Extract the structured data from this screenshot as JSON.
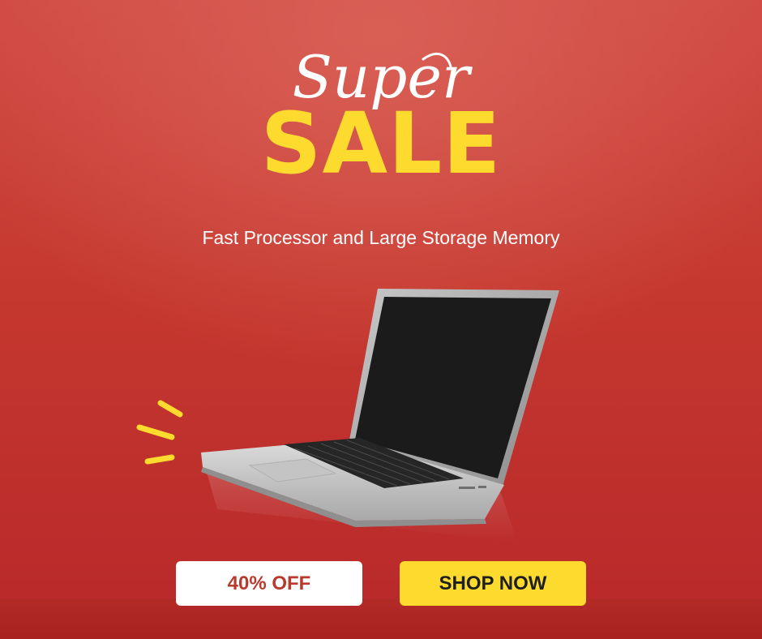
{
  "headline": {
    "script_word": "Super",
    "main_word": "SALE"
  },
  "subtitle": "Fast Processor and Large Storage Memory",
  "buttons": {
    "discount_label": "40% OFF",
    "shop_label": "SHOP NOW"
  },
  "colors": {
    "background": "#c5382f",
    "accent_yellow": "#fddb2e",
    "discount_text": "#b83a2c",
    "white": "#ffffff"
  },
  "icons": {
    "product": "laptop",
    "decoration": "sparkle-lines"
  }
}
